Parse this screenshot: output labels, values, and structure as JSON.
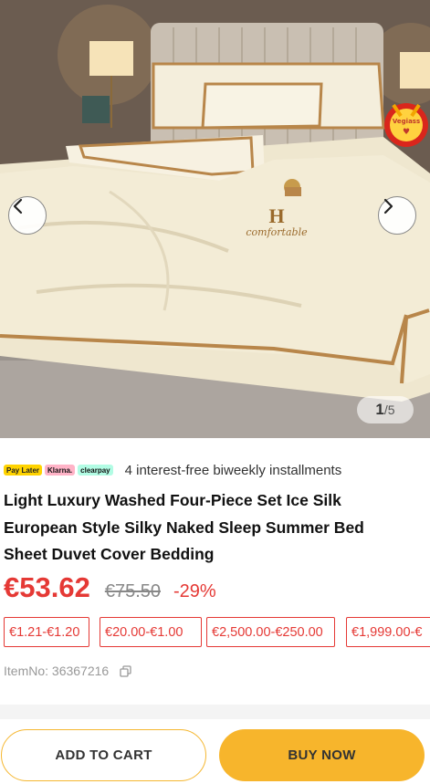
{
  "gallery": {
    "current": "1",
    "separator": "/",
    "total": "5",
    "prev_icon": "chevron-left-icon",
    "next_icon": "chevron-right-icon",
    "image_embroidery_brand": "H",
    "image_embroidery_text": "comfortable",
    "badge_text": "Vegiass"
  },
  "payments": {
    "paylater_label": "Pay Later",
    "klarna_label": "Klarna.",
    "clearpay_label": "clearpay",
    "installments_text": "4 interest-free biweekly installments"
  },
  "product": {
    "title": "Light Luxury Washed Four-Piece Set Ice Silk European Style Silky Naked Sleep Summer Bed Sheet Duvet Cover Bedding",
    "price": "€53.62",
    "original_price": "€75.50",
    "discount": "-29%",
    "price_tiers": [
      "€1.21-€1.20",
      "€20.00-€1.00",
      "€2,500.00-€250.00",
      "€1,999.00-€"
    ],
    "item_no_label": "ItemNo: 36367216",
    "copy_icon": "copy-icon"
  },
  "actions": {
    "add_to_cart": "ADD TO CART",
    "buy_now": "BUY NOW"
  },
  "colors": {
    "price_red": "#e53935",
    "accent_yellow": "#f7b52c",
    "bedding_cream": "#f3ecd6",
    "trim_gold": "#b8864a"
  }
}
